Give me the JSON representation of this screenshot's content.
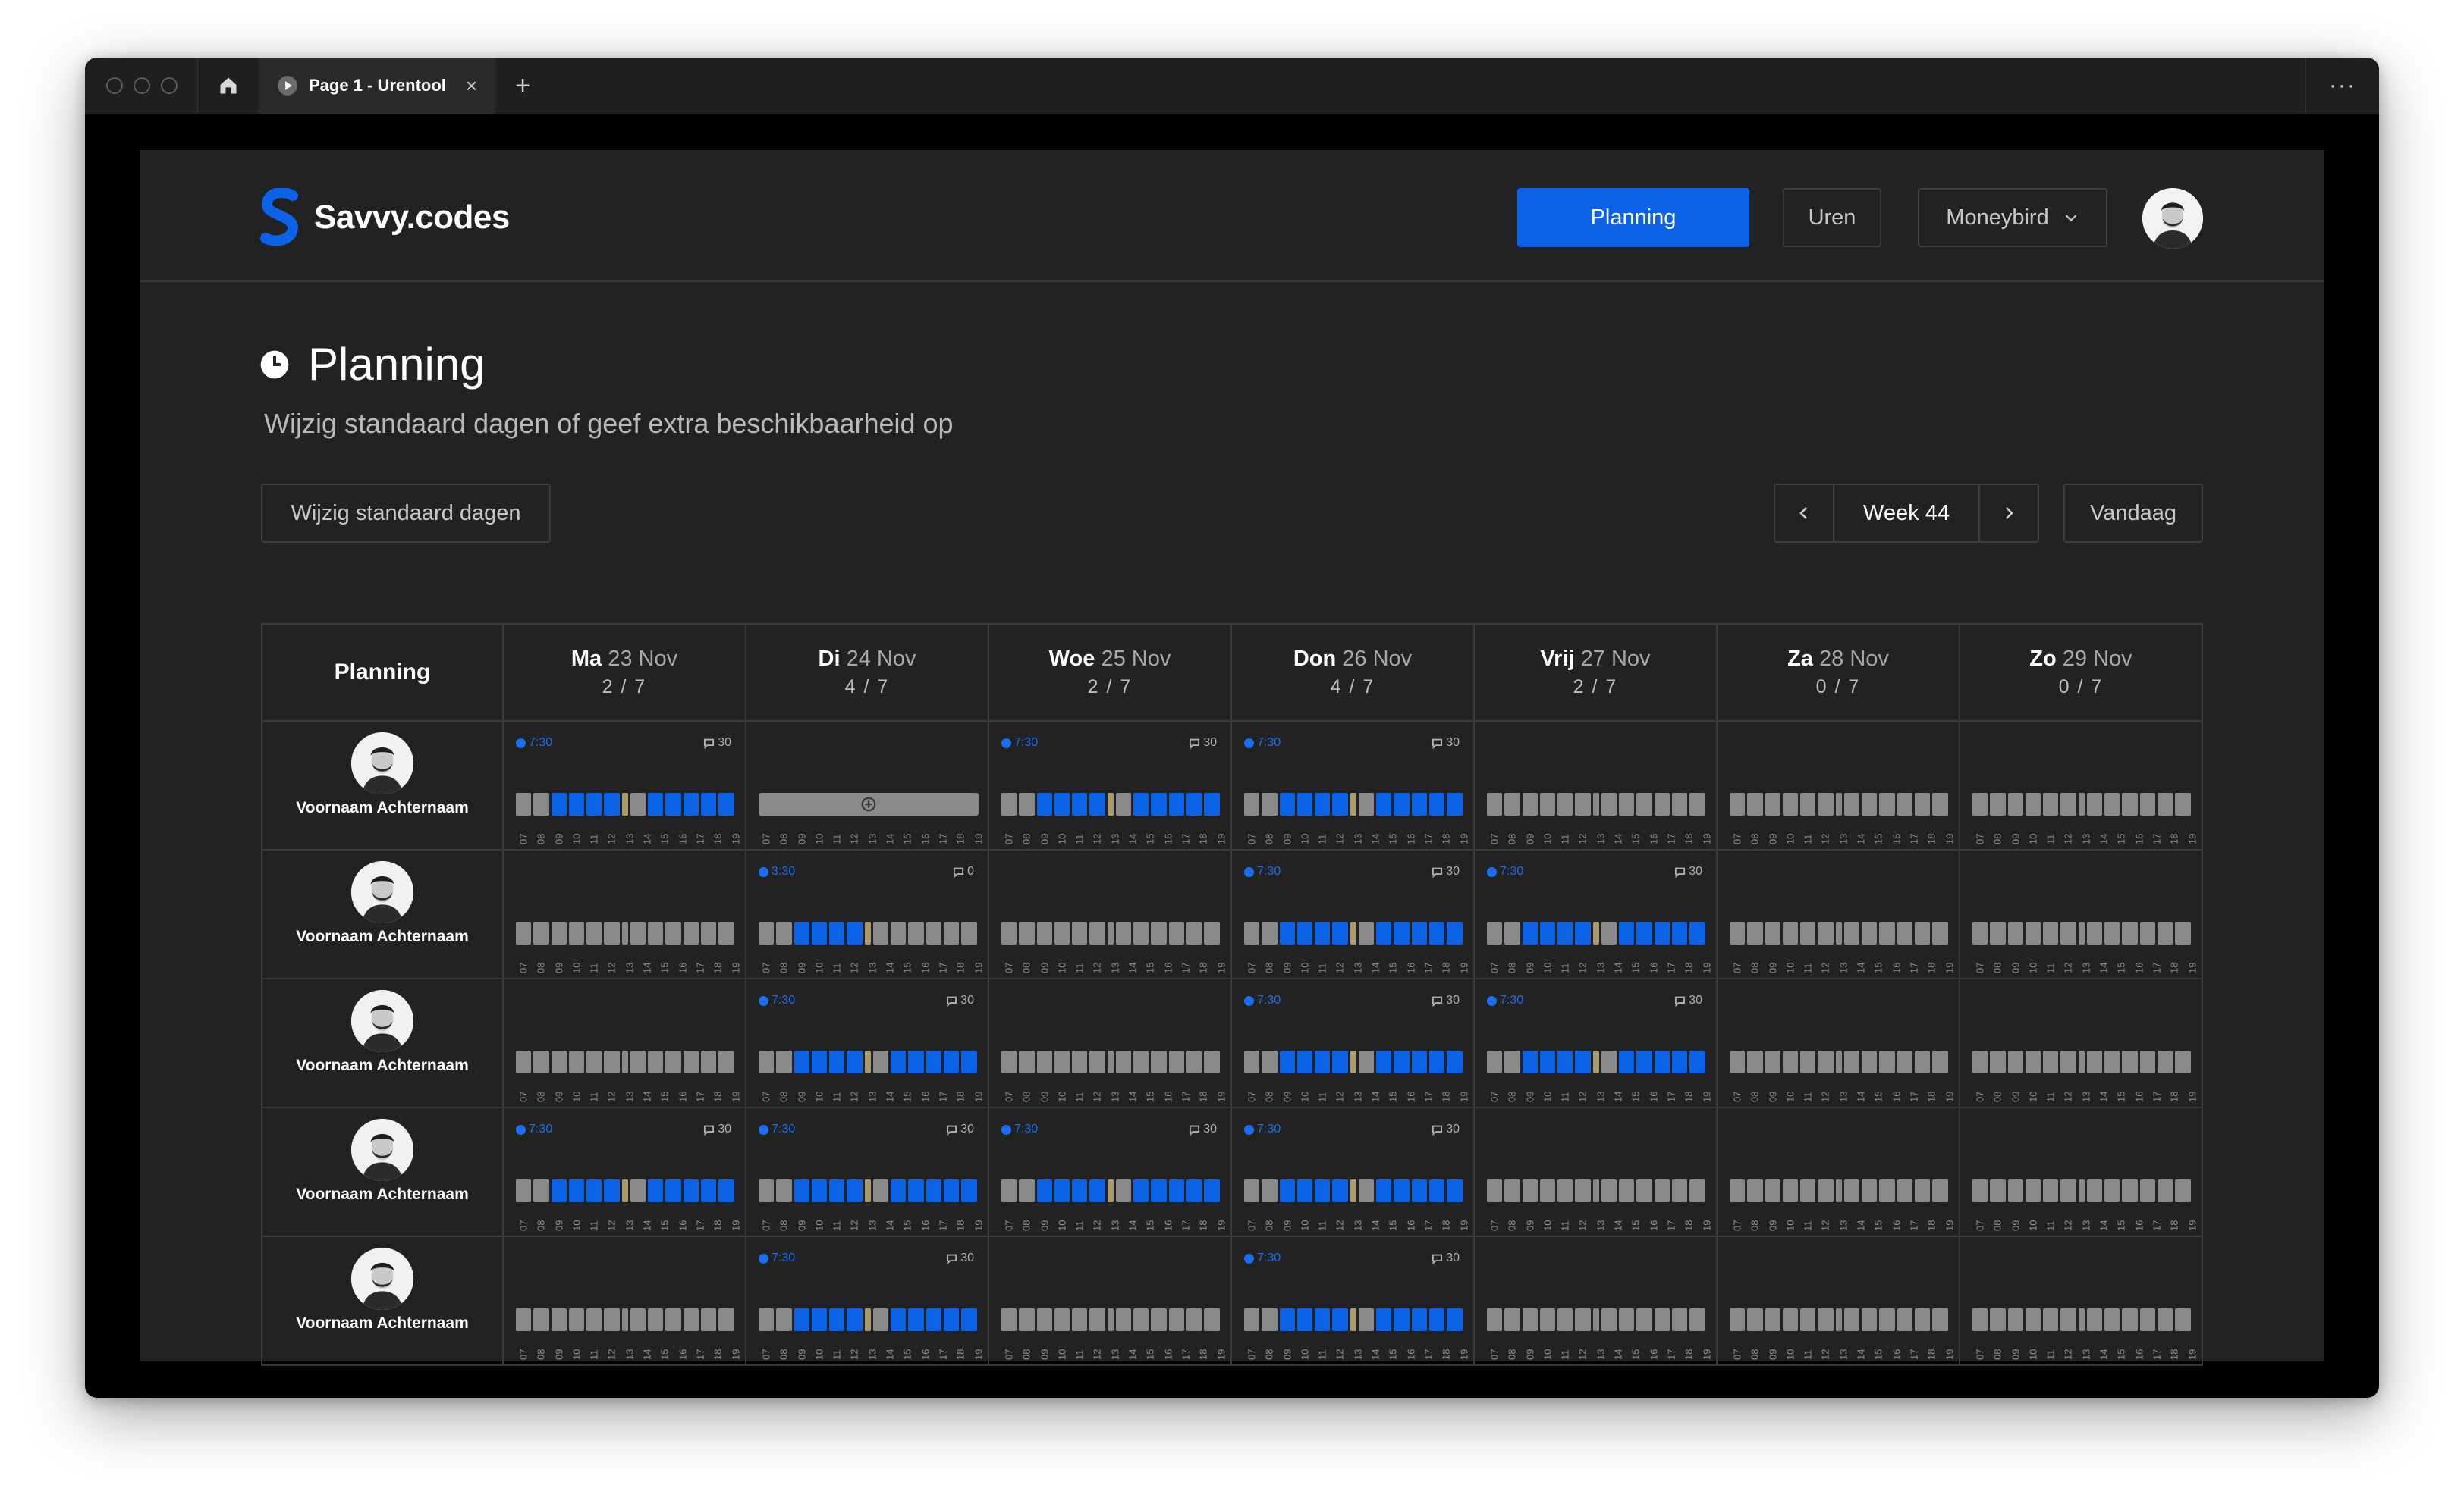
{
  "browser": {
    "tab_title": "Page 1 - Urentool",
    "tab_close": "×",
    "new_tab": "+",
    "more": "···"
  },
  "header": {
    "brand": "Savvy.codes",
    "nav": {
      "planning": "Planning",
      "uren": "Uren",
      "moneybird": "Moneybird"
    }
  },
  "page": {
    "title": "Planning",
    "subtitle": "Wijzig standaard dagen of geef extra beschikbaarheid op",
    "edit_default_button": "Wijzig standaard dagen",
    "week_label": "Week 44",
    "today_button": "Vandaag"
  },
  "colors": {
    "accent": "#0b62e6",
    "background": "#222222",
    "slot_off": "#8a8a8a",
    "break": "#a99a70"
  },
  "grid": {
    "corner_label": "Planning",
    "days": [
      {
        "name": "Ma",
        "date": "23 Nov",
        "count": "2 / 7"
      },
      {
        "name": "Di",
        "date": "24 Nov",
        "count": "4 / 7"
      },
      {
        "name": "Woe",
        "date": "25 Nov",
        "count": "2 / 7"
      },
      {
        "name": "Don",
        "date": "26 Nov",
        "count": "4 / 7"
      },
      {
        "name": "Vrij",
        "date": "27 Nov",
        "count": "2 / 7"
      },
      {
        "name": "Za",
        "date": "28 Nov",
        "count": "0 / 7"
      },
      {
        "name": "Zo",
        "date": "29 Nov",
        "count": "0 / 7"
      }
    ],
    "hours": [
      "07",
      "08",
      "09",
      "10",
      "11",
      "12",
      "13",
      "14",
      "15",
      "16",
      "17",
      "18",
      "19"
    ],
    "rows": [
      {
        "name": "Voornaam Achternaam",
        "cells": [
          {
            "state": "full",
            "time": "7:30",
            "comments": "30"
          },
          {
            "state": "add"
          },
          {
            "state": "full",
            "time": "7:30",
            "comments": "30"
          },
          {
            "state": "full",
            "time": "7:30",
            "comments": "30"
          },
          {
            "state": "empty"
          },
          {
            "state": "empty"
          },
          {
            "state": "empty"
          }
        ]
      },
      {
        "name": "Voornaam Achternaam",
        "cells": [
          {
            "state": "empty"
          },
          {
            "state": "half",
            "time": "3:30",
            "comments": "0"
          },
          {
            "state": "empty"
          },
          {
            "state": "full",
            "time": "7:30",
            "comments": "30"
          },
          {
            "state": "full",
            "time": "7:30",
            "comments": "30"
          },
          {
            "state": "empty"
          },
          {
            "state": "empty"
          }
        ]
      },
      {
        "name": "Voornaam Achternaam",
        "cells": [
          {
            "state": "empty"
          },
          {
            "state": "full",
            "time": "7:30",
            "comments": "30"
          },
          {
            "state": "empty"
          },
          {
            "state": "full",
            "time": "7:30",
            "comments": "30"
          },
          {
            "state": "full",
            "time": "7:30",
            "comments": "30"
          },
          {
            "state": "empty"
          },
          {
            "state": "empty"
          }
        ]
      },
      {
        "name": "Voornaam Achternaam",
        "cells": [
          {
            "state": "full",
            "time": "7:30",
            "comments": "30"
          },
          {
            "state": "full",
            "time": "7:30",
            "comments": "30"
          },
          {
            "state": "full",
            "time": "7:30",
            "comments": "30"
          },
          {
            "state": "full",
            "time": "7:30",
            "comments": "30"
          },
          {
            "state": "empty"
          },
          {
            "state": "empty"
          },
          {
            "state": "empty"
          }
        ]
      },
      {
        "name": "Voornaam Achternaam",
        "cells": [
          {
            "state": "empty"
          },
          {
            "state": "full",
            "time": "7:30",
            "comments": "30"
          },
          {
            "state": "empty"
          },
          {
            "state": "full",
            "time": "7:30",
            "comments": "30"
          },
          {
            "state": "empty"
          },
          {
            "state": "empty"
          },
          {
            "state": "empty"
          }
        ]
      }
    ]
  }
}
